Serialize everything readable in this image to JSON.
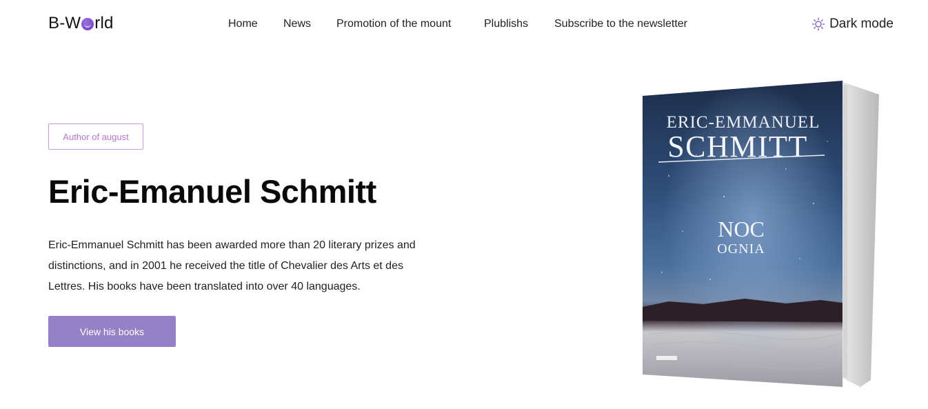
{
  "header": {
    "logo_prefix": "B-W",
    "logo_suffix": "rld",
    "nav": [
      "Home",
      "News",
      "Promotion of the mount",
      "Plublishs",
      "Subscribe to the newsletter"
    ],
    "dark_mode_label": "Dark mode"
  },
  "hero": {
    "badge": "Author of august",
    "title": "Eric-Emanuel Schmitt",
    "description": "Eric-Emmanuel Schmitt has been awarded more than 20 literary prizes and distinctions, and in 2001 he received the title of Chevalier des Arts et des Lettres. His books have been translated into over 40 languages.",
    "cta_label": "View his books"
  },
  "book": {
    "author_line1": "ERIC-EMMANUEL",
    "author_line2": "SCHMITT",
    "title_line1": "NOC",
    "title_line2": "OGNIA"
  },
  "colors": {
    "accent": "#9581c6",
    "badge_border": "#c59ad9",
    "badge_text": "#b479c8"
  }
}
